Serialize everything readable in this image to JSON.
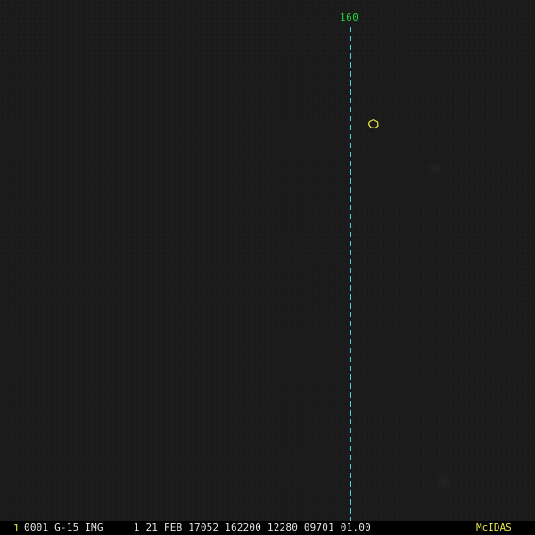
{
  "overlay": {
    "meridian_label": "160"
  },
  "status_bar": {
    "frame_number": "1",
    "text": "0001 G-15 IMG     1 21 FEB 17052 162200 12280 09701 01.00",
    "brand": "McIDAS"
  },
  "colors": {
    "background": "#1b1b1b",
    "meridian_line": "#4fd0d6",
    "meridian_label": "#22d640",
    "coastline": "#e8e84a",
    "status_text": "#e4e4e4",
    "frame_number": "#e8e84a",
    "brand": "#e8e84a"
  }
}
